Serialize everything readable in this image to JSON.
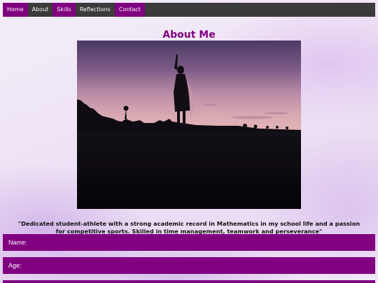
{
  "nav": {
    "items": [
      {
        "label": "Home"
      },
      {
        "label": "About"
      },
      {
        "label": "Skills"
      },
      {
        "label": "Reflections"
      },
      {
        "label": "Contact"
      }
    ]
  },
  "page": {
    "title": "About Me"
  },
  "quote": {
    "text": "\"Dedicated student-athlete with a strong academic record in Mathematics in my school life and a passion for competitive sports. Skilled in time management, teamwork and perseverance\""
  },
  "form": {
    "name_label": "Name:",
    "age_label": "Age:"
  },
  "colors": {
    "accent": "#800080",
    "nav_bg": "#3b3b3b"
  }
}
